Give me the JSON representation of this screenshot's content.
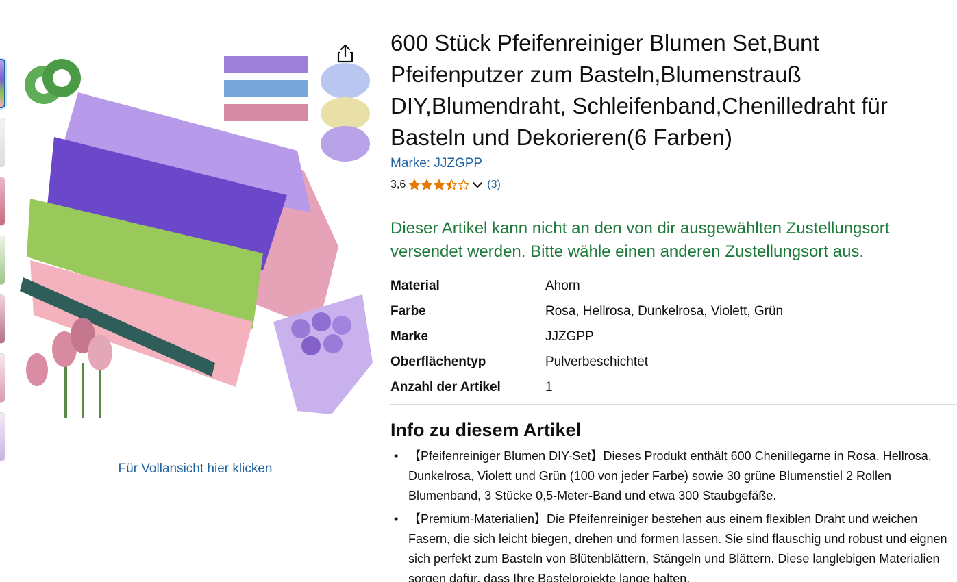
{
  "product": {
    "title": "600 Stück Pfeifenreiniger Blumen Set,Bunt Pfeifenputzer zum Basteln,Blumenstrauß DIY,Blumendraht, Schleifenband,Chenilledraht für Basteln und Dekorieren(6 Farben)",
    "brand_link": "Marke: JJZGPP",
    "rating_value": "3,6",
    "rating_stars": 3.5,
    "review_count": "(3)",
    "availability": "Dieser Artikel kann nicht an den von dir ausgewählten Zustellungsort versendet werden. Bitte wähle einen anderen Zustellungsort aus.",
    "full_view_link": "Für Vollansicht hier klicken"
  },
  "specs": [
    {
      "key": "Material",
      "value": "Ahorn"
    },
    {
      "key": "Farbe",
      "value": "Rosa, Hellrosa, Dunkelrosa, Violett, Grün"
    },
    {
      "key": "Marke",
      "value": "JJZGPP"
    },
    {
      "key": "Oberflächentyp",
      "value": "Pulverbeschichtet"
    },
    {
      "key": "Anzahl der Artikel",
      "value": "1"
    }
  ],
  "about": {
    "heading": "Info zu diesem Artikel",
    "bullets": [
      "【Pfeifenreiniger Blumen DIY-Set】Dieses Produkt enthält 600 Chenillegarne in Rosa, Hellrosa, Dunkelrosa, Violett und Grün (100 von jeder Farbe) sowie 30 grüne Blumenstiel 2 Rollen Blumenband, 3 Stücke 0,5-Meter-Band und etwa 300 Staubgefäße.",
      "【Premium-Materialien】Die Pfeifenreiniger bestehen aus einem flexiblen Draht und weichen Fasern, die sich leicht biegen, drehen und formen lassen. Sie sind flauschig und robust und eignen sich perfekt zum Basteln von Blütenblättern, Stängeln und Blättern. Diese langlebigen Materialien sorgen dafür, dass Ihre Bastelprojekte lange halten."
    ]
  },
  "colors": {
    "link": "#2162a1",
    "availability": "#1d7a3a",
    "star": "#e67a00",
    "divider": "#d5d9d9"
  },
  "icons": {
    "share": "share-icon",
    "star": "star-icon",
    "chevron": "chevron-down-icon"
  }
}
